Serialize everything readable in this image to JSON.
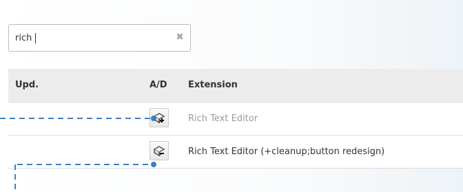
{
  "search": {
    "value": "rich",
    "clear_icon": "close-icon"
  },
  "table": {
    "headers": {
      "upd": "Upd.",
      "ad": "A/D",
      "extension": "Extension"
    },
    "rows": [
      {
        "extension": "Rich Text Editor",
        "status": "not installed",
        "action_icon": "install-extension-icon"
      },
      {
        "extension": "Rich Text Editor (+cleanup;button redesign)",
        "status": "installed",
        "action_icon": "uninstall-extension-icon"
      }
    ]
  },
  "colors": {
    "connector": "#3a7fc4",
    "muted_text": "#9a9a9a",
    "header_bg": "#ececec"
  }
}
